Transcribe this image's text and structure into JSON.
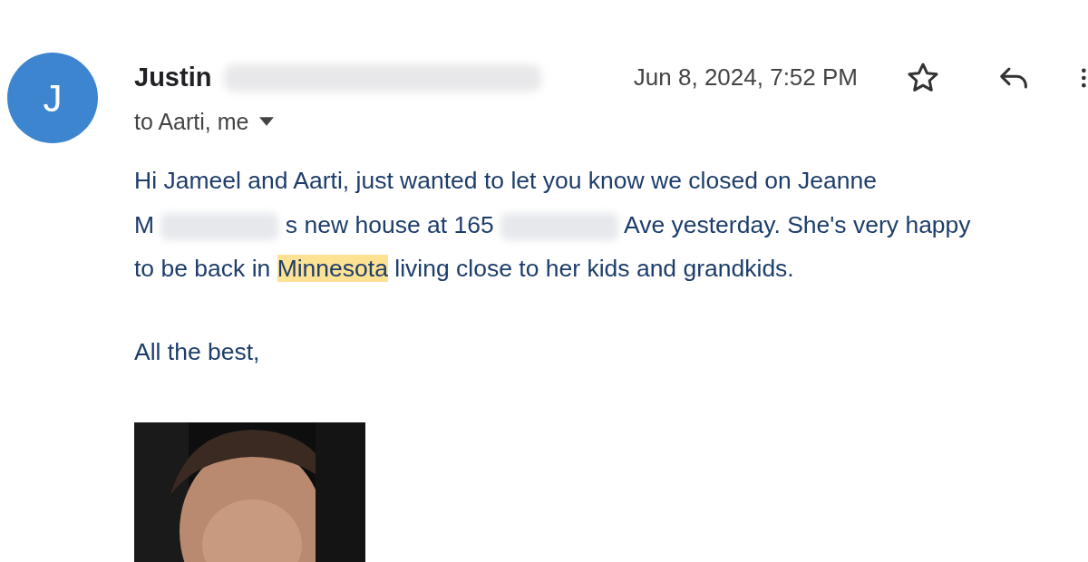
{
  "sender": {
    "avatar_letter": "J",
    "name": "Justin",
    "date": "Jun 8, 2024, 7:52 PM",
    "recipients": "to Aarti, me"
  },
  "body": {
    "lines": [
      [
        {
          "kind": "text",
          "text": "Hi Jameel and Aarti, just wanted to let you know we closed on Jeanne"
        }
      ],
      [
        {
          "kind": "text",
          "text": "M"
        },
        {
          "kind": "redacted"
        },
        {
          "kind": "text",
          "text": "s new house at 165"
        },
        {
          "kind": "redacted"
        },
        {
          "kind": "text",
          "text": "Ave yesterday. She's very happy"
        }
      ],
      [
        {
          "kind": "text",
          "text": "to be back in"
        },
        {
          "kind": "highlight",
          "text": "Minnesota"
        },
        {
          "kind": "text",
          "text": "living close to her kids and grandkids."
        }
      ]
    ],
    "signoff": "All the best,"
  }
}
